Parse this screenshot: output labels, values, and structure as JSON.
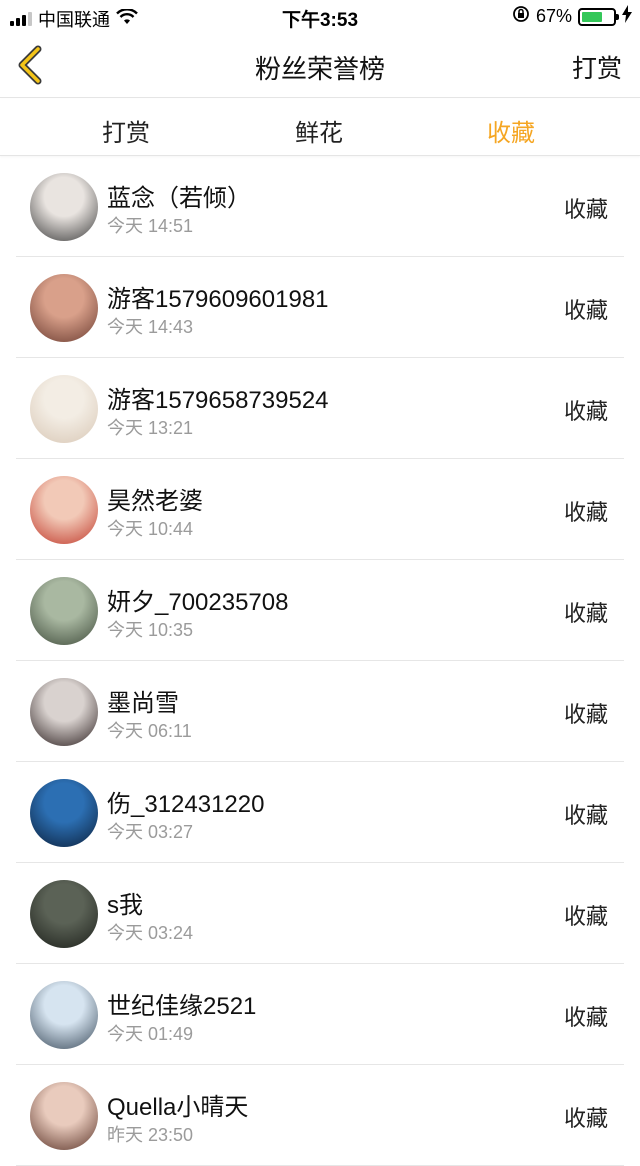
{
  "status_bar": {
    "carrier": "中国联通",
    "time": "下午3:53",
    "battery": "67%",
    "battery_level": 0.67
  },
  "nav": {
    "title": "粉丝荣誉榜",
    "right_action": "打赏"
  },
  "tabs": [
    {
      "label": "打赏",
      "active": false
    },
    {
      "label": "鲜花",
      "active": false
    },
    {
      "label": "收藏",
      "active": true
    }
  ],
  "accent_color": "#f5a623",
  "rows": [
    {
      "name": "蓝念（若倾）",
      "time": "今天 14:51",
      "action": "收藏",
      "avatar_colors": [
        "#e9e4e0",
        "#3b3b3b"
      ]
    },
    {
      "name": "游客1579609601981",
      "time": "今天 14:43",
      "action": "收藏",
      "avatar_colors": [
        "#d9a08a",
        "#6a3b30"
      ]
    },
    {
      "name": "游客1579658739524",
      "time": "今天 13:21",
      "action": "收藏",
      "avatar_colors": [
        "#f3ede4",
        "#d8c7b5"
      ]
    },
    {
      "name": "昊然老婆",
      "time": "今天 10:44",
      "action": "收藏",
      "avatar_colors": [
        "#f2c9b7",
        "#c0392b"
      ]
    },
    {
      "name": "妍夕_700235708",
      "time": "今天 10:35",
      "action": "收藏",
      "avatar_colors": [
        "#a9b8a1",
        "#3e4a3a"
      ]
    },
    {
      "name": "墨尚雪",
      "time": "今天 06:11",
      "action": "收藏",
      "avatar_colors": [
        "#d9d2cf",
        "#2a1e1e"
      ]
    },
    {
      "name": "伤_312431220",
      "time": "今天 03:27",
      "action": "收藏",
      "avatar_colors": [
        "#2c6fb3",
        "#0b1f3a"
      ]
    },
    {
      "name": "s我",
      "time": "今天 03:24",
      "action": "收藏",
      "avatar_colors": [
        "#5b6256",
        "#1c1f1a"
      ]
    },
    {
      "name": "世纪佳缘2521",
      "time": "今天 01:49",
      "action": "收藏",
      "avatar_colors": [
        "#d6e4f0",
        "#3a4a5a"
      ]
    },
    {
      "name": "Quella小晴天",
      "time": "昨天 23:50",
      "action": "收藏",
      "avatar_colors": [
        "#e9cbbd",
        "#5a3328"
      ]
    }
  ]
}
